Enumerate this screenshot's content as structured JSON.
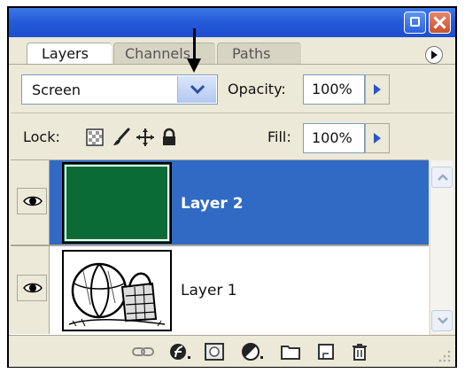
{
  "tabs": [
    {
      "label": "Layers",
      "active": true
    },
    {
      "label": "Channels",
      "active": false
    },
    {
      "label": "Paths",
      "active": false
    }
  ],
  "blend": {
    "mode": "Screen"
  },
  "opacity": {
    "label": "Opacity:",
    "value": "100%"
  },
  "lock": {
    "label": "Lock:"
  },
  "fill": {
    "label": "Fill:",
    "value": "100%"
  },
  "layers": [
    {
      "name": "Layer 2",
      "selected": true,
      "visible": true,
      "thumbnail": "solid-green",
      "thumb_color": "#0b6b37"
    },
    {
      "name": "Layer 1",
      "selected": false,
      "visible": true,
      "thumbnail": "beach-ball-sketch"
    }
  ],
  "colors": {
    "selection": "#316ac5",
    "titlebar": "#2459d8",
    "panel": "#ece9d8"
  },
  "icons": {
    "titlebar": [
      "restore-icon",
      "close-icon"
    ],
    "lock": [
      "lock-transparent-icon",
      "lock-brush-icon",
      "lock-move-icon",
      "lock-all-icon"
    ],
    "bottom": [
      "link-icon",
      "layer-style-icon",
      "mask-icon",
      "adjustment-icon",
      "group-folder-icon",
      "new-layer-icon",
      "trash-icon"
    ]
  }
}
